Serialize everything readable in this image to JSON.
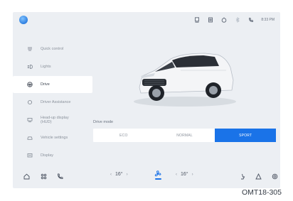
{
  "status_bar": {
    "time": "8:33 PM",
    "icons": [
      "phone-mirror-icon",
      "sim-icon",
      "timer-icon",
      "bluetooth-icon",
      "call-icon"
    ]
  },
  "sidebar": {
    "items": [
      {
        "label": "Quick control",
        "icon": "steering-icon",
        "active": false
      },
      {
        "label": "Lights",
        "icon": "light-icon",
        "active": false
      },
      {
        "label": "Drive",
        "icon": "steering-wheel-icon",
        "active": true
      },
      {
        "label": "Driver Assistance",
        "icon": "assist-icon",
        "active": false
      },
      {
        "label": "Head-up display (HUD)",
        "icon": "hud-icon",
        "active": false
      },
      {
        "label": "Vehicle settings",
        "icon": "car-icon",
        "active": false
      },
      {
        "label": "Display",
        "icon": "display-icon",
        "active": false
      }
    ]
  },
  "drive_mode": {
    "title": "Drive mode",
    "options": [
      "ECO",
      "NORMAL",
      "SPORT"
    ],
    "selected": "SPORT"
  },
  "dock": {
    "left_temp": "16",
    "right_temp": "16",
    "degree": "°",
    "arrow_left": "‹",
    "arrow_right": "›"
  },
  "caption": "OMT18-305",
  "colors": {
    "accent": "#1a73e8",
    "screen_bg": "#eceff3"
  }
}
